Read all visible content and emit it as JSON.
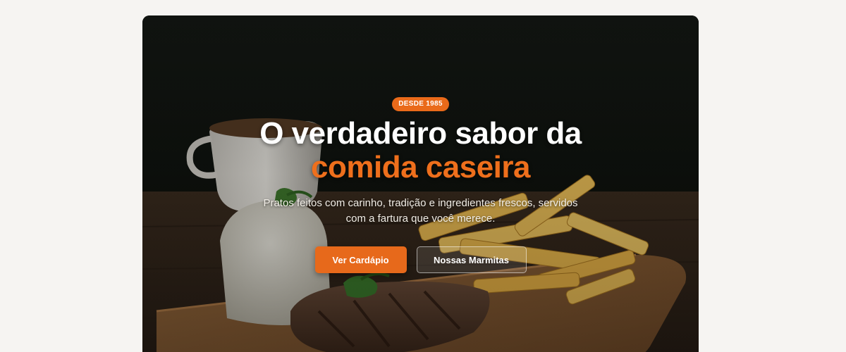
{
  "hero": {
    "badge": "DESDE 1985",
    "headline_line1": "O verdadeiro sabor da",
    "headline_line2": "comida caseira",
    "subtitle": "Pratos feitos com carinho, tradição e ingredientes frescos, servidos com a fartura que você merece.",
    "primary_button": "Ver Cardápio",
    "secondary_button": "Nossas Marmitas"
  },
  "colors": {
    "accent": "#ea6a1a",
    "page_background": "#f6f4f2",
    "hero_background": "#0f110f"
  },
  "image": {
    "subject": "food-photo"
  }
}
